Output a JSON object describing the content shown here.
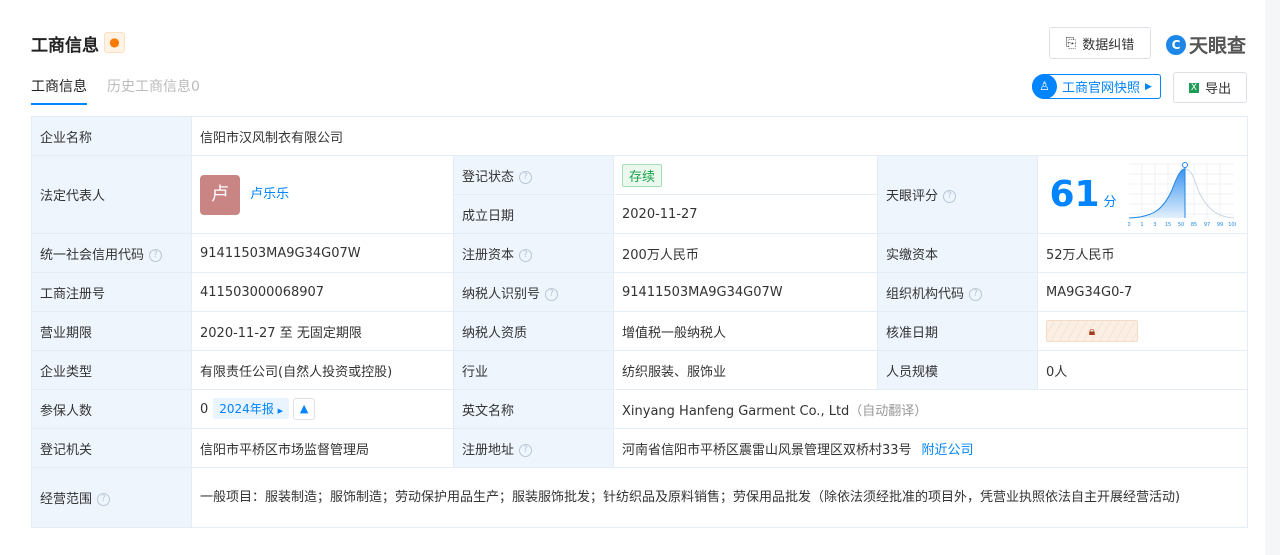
{
  "header": {
    "title": "工商信息",
    "correct_label": "数据纠错",
    "brand": "天眼查",
    "snapshot_label": "工商官网快照",
    "export_label": "导出"
  },
  "tabs": [
    {
      "label": "工商信息"
    },
    {
      "label": "历史工商信息0"
    }
  ],
  "rows": {
    "company_name": {
      "label": "企业名称",
      "value": "信阳市汉风制衣有限公司"
    },
    "legal_rep": {
      "label": "法定代表人",
      "avatar": "卢",
      "name": "卢乐乐"
    },
    "status": {
      "label": "登记状态",
      "value": "存续"
    },
    "found_date": {
      "label": "成立日期",
      "value": "2020-11-27"
    },
    "score": {
      "label": "天眼评分",
      "value": "61",
      "unit": "分",
      "ticks": [
        "0",
        "1",
        "3",
        "15",
        "50",
        "85",
        "97",
        "99",
        "100"
      ],
      "percentile": 61
    },
    "credit_code": {
      "label": "统一社会信用代码",
      "value": "91411503MA9G34G07W"
    },
    "reg_capital": {
      "label": "注册资本",
      "value": "200万人民币"
    },
    "paid_capital": {
      "label": "实缴资本",
      "value": "52万人民币"
    },
    "reg_no": {
      "label": "工商注册号",
      "value": "411503000068907"
    },
    "taxpayer_id": {
      "label": "纳税人识别号",
      "value": "91411503MA9G34G07W"
    },
    "org_code": {
      "label": "组织机构代码",
      "value": "MA9G34G0-7"
    },
    "term": {
      "label": "营业期限",
      "value": "2020-11-27 至 无固定期限"
    },
    "taxpayer_type": {
      "label": "纳税人资质",
      "value": "增值税一般纳税人"
    },
    "approve_date": {
      "label": "核准日期"
    },
    "company_type": {
      "label": "企业类型",
      "value": "有限责任公司(自然人投资或控股)"
    },
    "industry": {
      "label": "行业",
      "value": "纺织服装、服饰业"
    },
    "staff_size": {
      "label": "人员规模",
      "value": "0人"
    },
    "insured": {
      "label": "参保人数",
      "value": "0",
      "report": "2024年报"
    },
    "english_name": {
      "label": "英文名称",
      "value": "Xinyang Hanfeng Garment Co., Ltd",
      "note": "（自动翻译）"
    },
    "authority": {
      "label": "登记机关",
      "value": "信阳市平桥区市场监督管理局"
    },
    "address": {
      "label": "注册地址",
      "value": "河南省信阳市平桥区震雷山风景管理区双桥村33号",
      "nearby": "附近公司"
    },
    "scope": {
      "label": "经营范围",
      "value": "一般项目：服装制造；服饰制造；劳动保护用品生产；服装服饰批发；针纺织品及原料销售；劳保用品批发（除依法须经批准的项目外，凭营业执照依法自主开展经营活动)"
    }
  }
}
